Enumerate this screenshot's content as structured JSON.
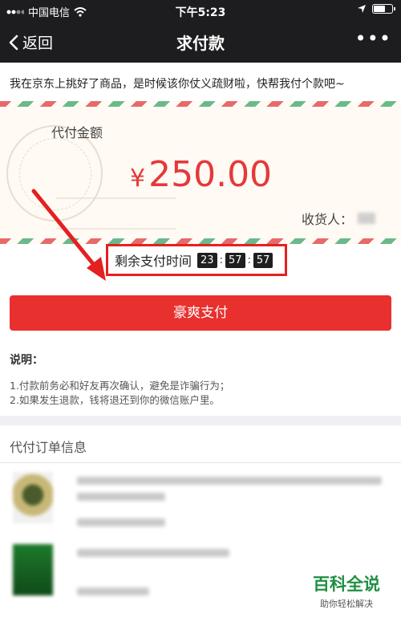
{
  "status_bar": {
    "carrier": "中国电信",
    "time": "下午5:23"
  },
  "nav": {
    "back_label": "返回",
    "title": "求付款",
    "more_label": "•••"
  },
  "message": "我在京东上挑好了商品，是时候该你仗义疏财啦，快帮我付个款吧~",
  "payment": {
    "amount_label": "代付金额",
    "currency_symbol": "¥",
    "amount": "250.00",
    "receiver_label": "收货人："
  },
  "timer": {
    "label": "剩余支付时间",
    "hours": "23",
    "minutes": "57",
    "seconds": "57",
    "separator": ":"
  },
  "pay_button_label": "豪爽支付",
  "notes": {
    "title": "说明：",
    "items": [
      "1.付款前务必和好友再次确认，避免是诈骗行为；",
      "2.如果发生退款，钱将退还到你的微信账户里。"
    ]
  },
  "orders": {
    "title": "代付订单信息"
  },
  "watermark": {
    "title": "百科全说",
    "subtitle": "助你轻松解决"
  },
  "colors": {
    "accent": "#e8302f",
    "nav_bg": "#1d1d20",
    "watermark_green": "#1f8f43",
    "annotation_red": "#e42020"
  },
  "icons": [
    "signal-icon",
    "wifi-icon",
    "location-icon",
    "battery-icon",
    "chevron-left-icon",
    "more-icon",
    "annotation-arrow-icon"
  ]
}
